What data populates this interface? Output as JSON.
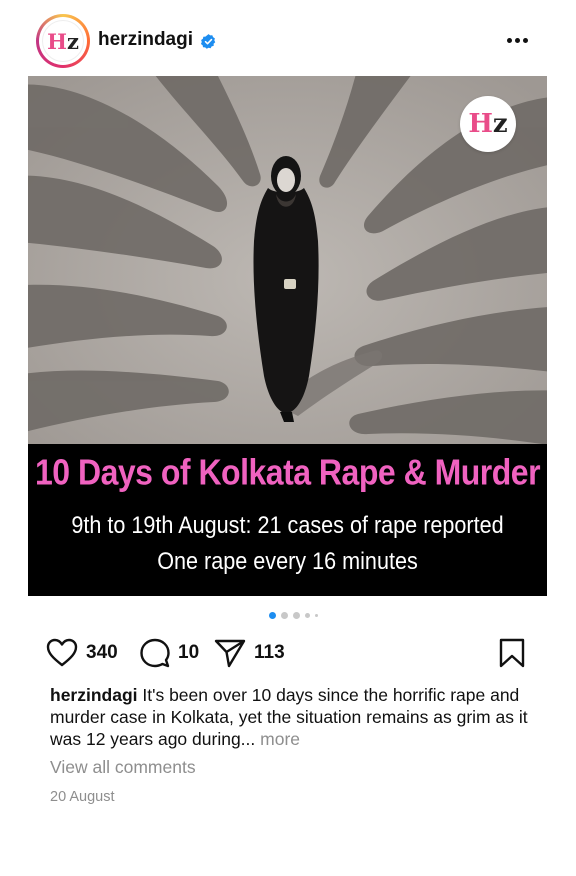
{
  "post": {
    "username": "herzindagi",
    "avatar_logo": {
      "h": "H",
      "z": "z"
    },
    "verified_icon": "verified-badge-icon",
    "more_icon": "more-options-icon",
    "image": {
      "brand_logo": {
        "h": "H",
        "z": "z"
      },
      "headline": "10 Days of Kolkata Rape & Murder",
      "subline_1": "9th to 19th August: 21 cases of rape reported",
      "subline_2": "One rape every 16 minutes",
      "headline_color": "#f062c0"
    },
    "carousel": {
      "total": 5,
      "active_index": 0
    },
    "actions": {
      "likes": "340",
      "comments": "10",
      "shares": "113"
    },
    "caption": {
      "username": "herzindagi",
      "text": "It's been over 10 days since the horrific rape and murder case in Kolkata, yet the situation remains as grim as it was 12 years ago during...",
      "more_label": "more"
    },
    "view_comments_label": "View all comments",
    "date": "20 August"
  },
  "colors": {
    "accent": "#1d8df0",
    "muted": "#8e8e8e",
    "brand_pink": "#e94c89"
  }
}
